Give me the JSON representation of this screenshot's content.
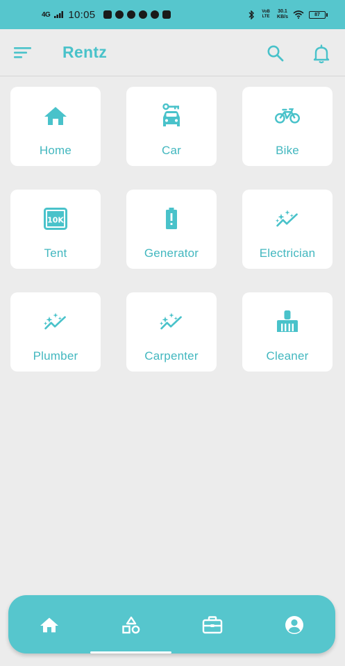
{
  "status_bar": {
    "network": "4G",
    "time": "10:05",
    "volte": "VoB LTE",
    "speed_value": "30.1",
    "speed_unit": "KB/s",
    "battery": "87"
  },
  "app_bar": {
    "title": "Rentz",
    "menu_icon": "sort-menu-icon",
    "search_icon": "search-icon",
    "notifications_icon": "bell-icon"
  },
  "categories": [
    {
      "label": "Home",
      "icon": "home-icon"
    },
    {
      "label": "Car",
      "icon": "car-rental-icon"
    },
    {
      "label": "Bike",
      "icon": "bike-icon"
    },
    {
      "label": "Tent",
      "icon": "10k-icon"
    },
    {
      "label": "Generator",
      "icon": "battery-alert-icon"
    },
    {
      "label": "Electrician",
      "icon": "sparkle-icon"
    },
    {
      "label": "Plumber",
      "icon": "sparkle-icon"
    },
    {
      "label": "Carpenter",
      "icon": "sparkle-icon"
    },
    {
      "label": "Cleaner",
      "icon": "cleaning-brush-icon"
    }
  ],
  "bottom_nav": [
    {
      "icon": "home-icon"
    },
    {
      "icon": "category-icon"
    },
    {
      "icon": "briefcase-icon"
    },
    {
      "icon": "account-circle-icon"
    }
  ],
  "colors": {
    "accent": "#56c6cd",
    "accent_text": "#42b7bf",
    "background": "#ececec",
    "card": "#ffffff"
  }
}
